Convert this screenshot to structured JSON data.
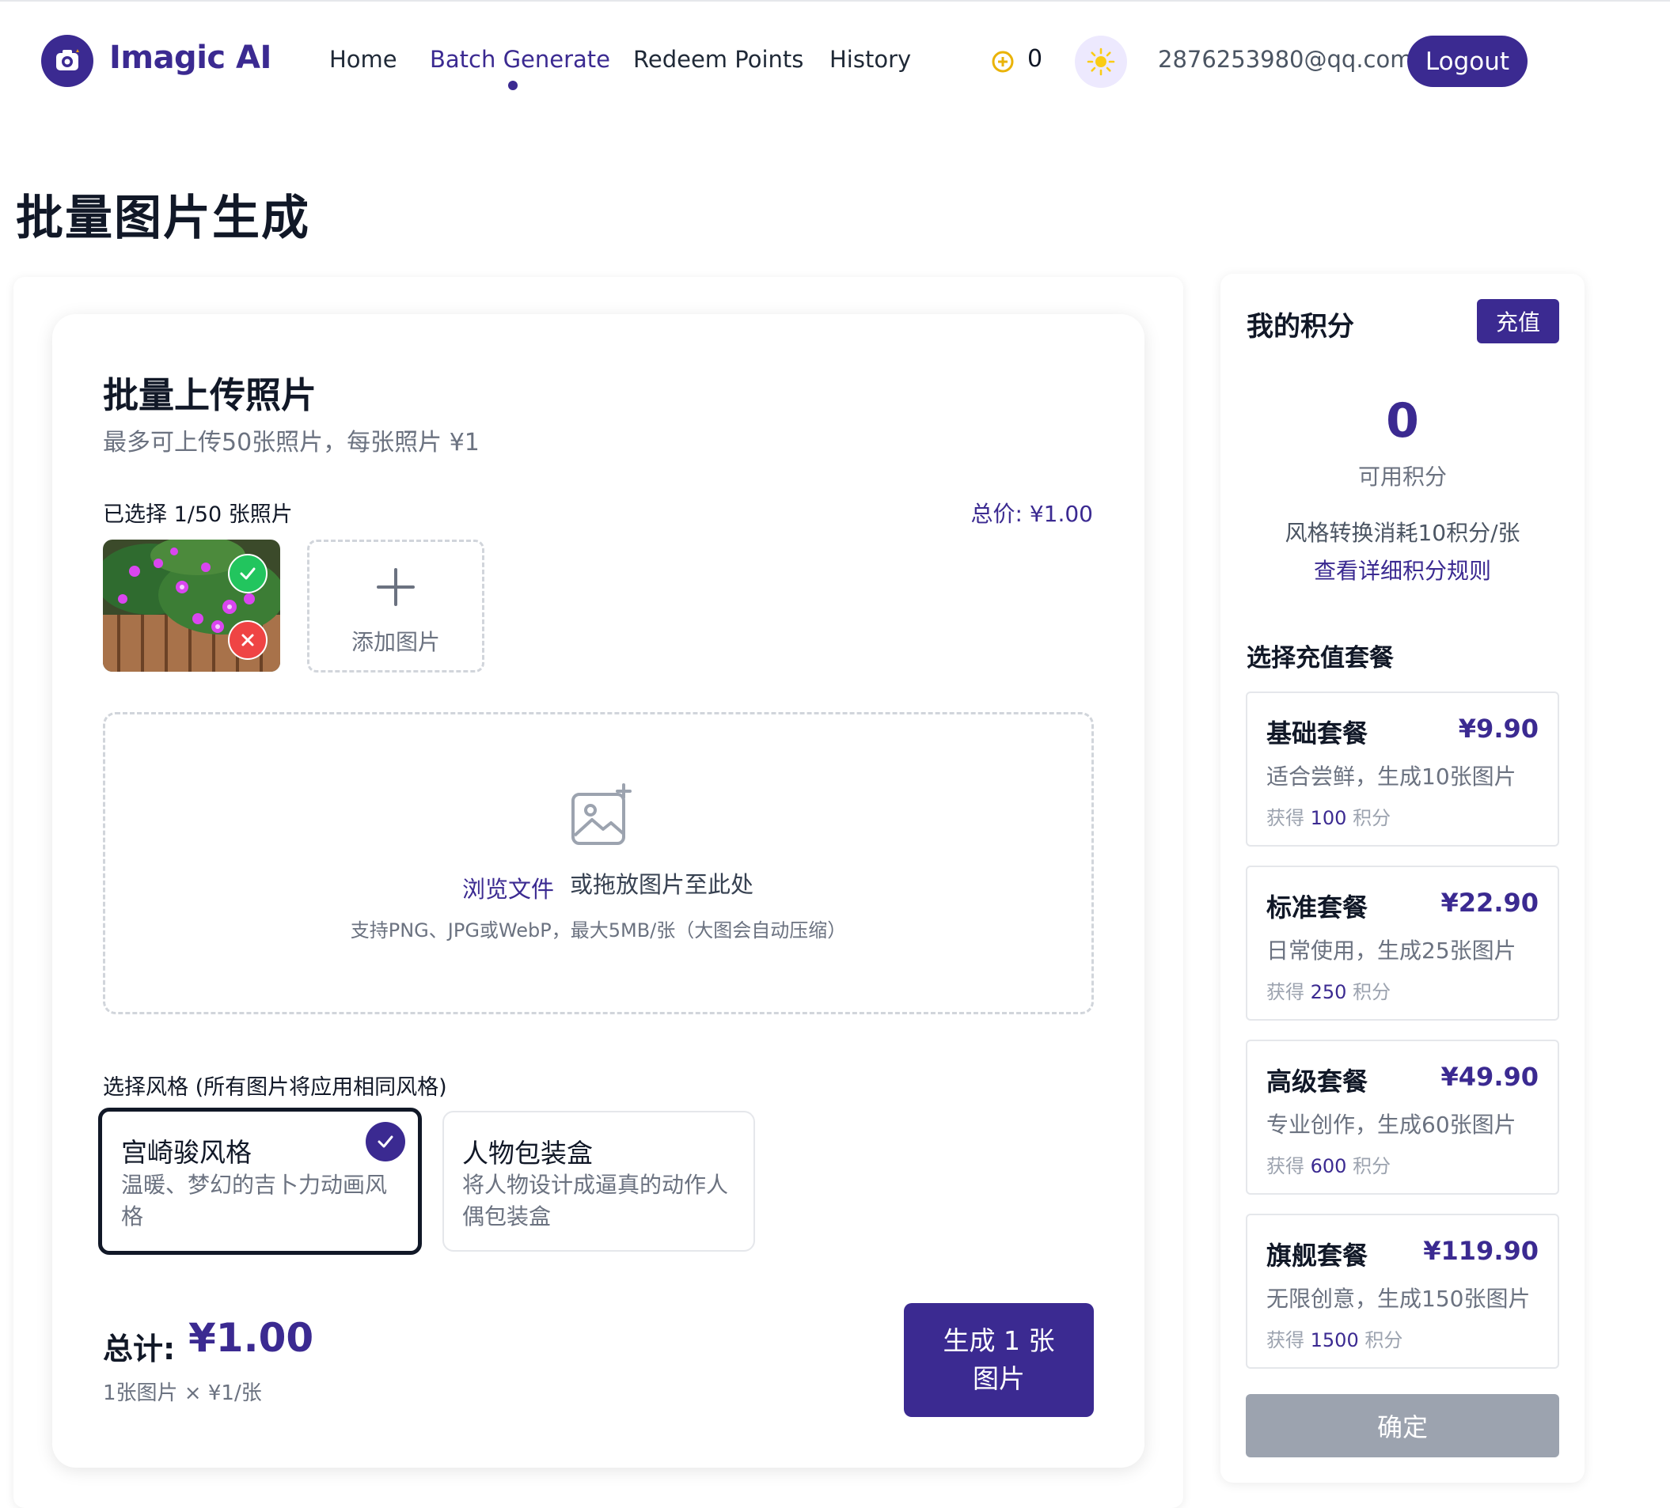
{
  "header": {
    "brand": "Imagic AI",
    "nav": [
      "Home",
      "Batch Generate",
      "Redeem Points",
      "History"
    ],
    "active_nav": "Batch Generate",
    "points": "0",
    "user_email": "2876253980@qq.com",
    "logout_label": "Logout"
  },
  "page_title": "批量图片生成",
  "upload": {
    "title": "批量上传照片",
    "subtitle": "最多可上传50张照片，每张照片 ¥1",
    "selected_count": "已选择 1/50 张照片",
    "total_price": "总价: ¥1.00",
    "add_label": "添加图片",
    "browse_label": "浏览文件",
    "drop_text": "或拖放图片至此处",
    "drop_hint": "支持PNG、JPG或WebP，最大5MB/张（大图会自动压缩）"
  },
  "styles": {
    "label": "选择风格 (所有图片将应用相同风格)",
    "options": [
      {
        "name": "宫崎骏风格",
        "desc_line1": "温暖、梦幻的吉卜力动画风",
        "desc_line2": "格",
        "selected": true
      },
      {
        "name": "人物包装盒",
        "desc_line1": "将人物设计成逼真的动作人",
        "desc_line2": "偶包装盒",
        "selected": false
      }
    ]
  },
  "summary": {
    "label": "总计:",
    "value": "¥1.00",
    "detail": "1张图片 × ¥1/张",
    "generate_line1": "生成 1 张",
    "generate_line2": "图片"
  },
  "sidebar": {
    "title": "我的积分",
    "recharge_label": "充值",
    "points_value": "0",
    "points_caption": "可用积分",
    "cost_note": "风格转换消耗10积分/张",
    "rules_link": "查看详细积分规则",
    "packages_heading": "选择充值套餐",
    "packages": [
      {
        "name": "基础套餐",
        "price": "¥9.90",
        "desc": "适合尝鲜，生成10张图片",
        "gain_prefix": "获得",
        "gain_value": "100",
        "gain_suffix": "积分"
      },
      {
        "name": "标准套餐",
        "price": "¥22.90",
        "desc": "日常使用，生成25张图片",
        "gain_prefix": "获得",
        "gain_value": "250",
        "gain_suffix": "积分"
      },
      {
        "name": "高级套餐",
        "price": "¥49.90",
        "desc": "专业创作，生成60张图片",
        "gain_prefix": "获得",
        "gain_value": "600",
        "gain_suffix": "积分"
      },
      {
        "name": "旗舰套餐",
        "price": "¥119.90",
        "desc": "无限创意，生成150张图片",
        "gain_prefix": "获得",
        "gain_value": "1500",
        "gain_suffix": "积分"
      }
    ],
    "confirm_label": "确定"
  },
  "colors": {
    "brand": "#3b2a91",
    "success": "#22c55e",
    "danger": "#ef4444",
    "disabled": "#9ca3af"
  },
  "icons": [
    "camera-logo-icon",
    "coin-plus-icon",
    "sun-icon",
    "check-icon",
    "close-icon",
    "plus-icon",
    "image-add-icon"
  ]
}
